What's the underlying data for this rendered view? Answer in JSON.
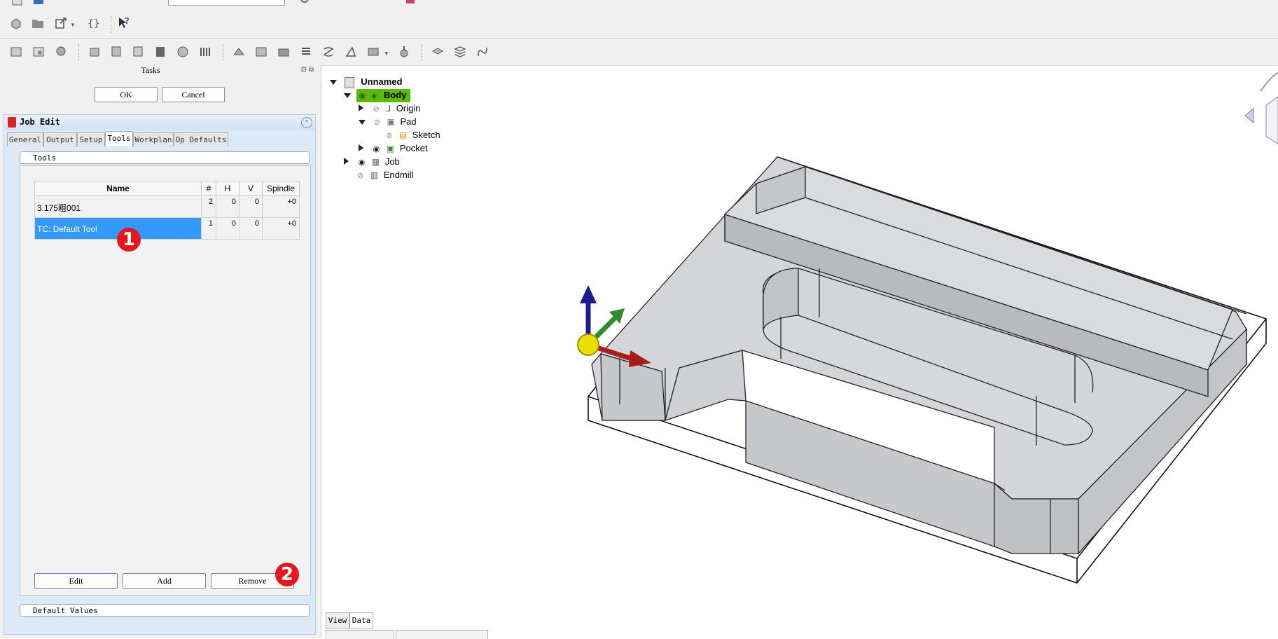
{
  "tasks": {
    "title": "Tasks",
    "ok_label": "OK",
    "cancel_label": "Cancel",
    "job_edit_title": "Job Edit",
    "tabs": [
      {
        "label": "General"
      },
      {
        "label": "Output"
      },
      {
        "label": "Setup"
      },
      {
        "label": "Tools"
      },
      {
        "label": "Workplan"
      },
      {
        "label": "Op Defaults"
      }
    ],
    "active_tab": "Tools",
    "tools_group_label": "Tools",
    "default_values_label": "Default Values",
    "table": {
      "headers": [
        "Name",
        "#",
        "H",
        "V",
        "Spindle"
      ],
      "rows": [
        {
          "name": "3.175粗001",
          "num": "2",
          "h": "0",
          "v": "0",
          "spindle": "+0",
          "selected": false
        },
        {
          "name": "TC: Default Tool",
          "num": "1",
          "h": "0",
          "v": "0",
          "spindle": "+0",
          "selected": true
        }
      ]
    },
    "edit_label": "Edit",
    "add_label": "Add",
    "remove_label": "Remove",
    "badges": [
      "1",
      "2"
    ]
  },
  "tree": {
    "items": [
      {
        "label": "Unnamed",
        "bold": true
      },
      {
        "label": "Body",
        "bold": true,
        "highlight": true
      },
      {
        "label": "Origin"
      },
      {
        "label": "Pad"
      },
      {
        "label": "Sketch"
      },
      {
        "label": "Pocket"
      },
      {
        "label": "Job"
      },
      {
        "label": "Endmill"
      }
    ]
  },
  "bottom_tabs": {
    "view": "View",
    "data": "Data"
  },
  "colors": {
    "selection": "#3399ff",
    "body_highlight": "#5cb800",
    "badge": "#e8161b",
    "axis_z": "#1c1c8c",
    "axis_y": "#2e8b2e",
    "axis_x": "#a81c1c",
    "model_fill": "#d4d5d8"
  }
}
